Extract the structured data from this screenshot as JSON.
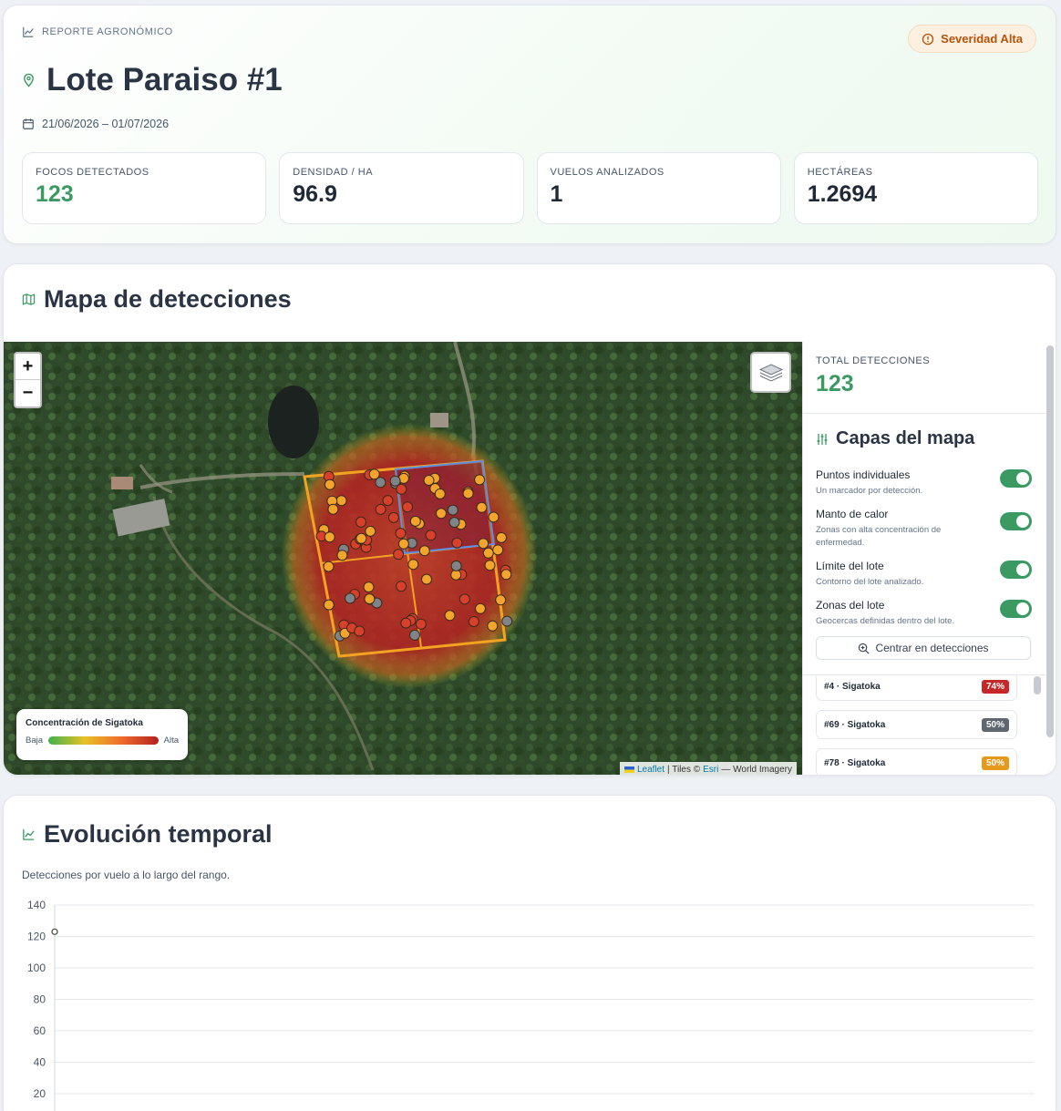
{
  "header": {
    "eyebrow": "REPORTE AGRONÓMICO",
    "severity_badge": "Severidad Alta",
    "title": "Lote Paraiso #1",
    "date_range": "21/06/2026 – 01/07/2026"
  },
  "stats": [
    {
      "label": "FOCOS DETECTADOS",
      "value": "123"
    },
    {
      "label": "DENSIDAD / HA",
      "value": "96.9"
    },
    {
      "label": "VUELOS ANALIZADOS",
      "value": "1"
    },
    {
      "label": "HECTÁREAS",
      "value": "1.2694"
    }
  ],
  "map_section": {
    "title": "Mapa de detecciones",
    "zoom_in": "+",
    "zoom_out": "−",
    "legend": {
      "title": "Concentración de Sigatoka",
      "low": "Baja",
      "high": "Alta"
    },
    "attribution": {
      "leaflet": "Leaflet",
      "sep1": "| Tiles ©",
      "esri": "Esri",
      "rest": "— World Imagery"
    }
  },
  "panel": {
    "total_label": "TOTAL DETECCIONES",
    "total_value": "123",
    "layers_title": "Capas del mapa",
    "layers": [
      {
        "name": "Puntos individuales",
        "desc": "Un marcador por detección.",
        "on": true
      },
      {
        "name": "Manto de calor",
        "desc": "Zonas con alta concentración de enfermedad.",
        "on": true
      },
      {
        "name": "Límite del lote",
        "desc": "Contorno del lote analizado.",
        "on": true
      },
      {
        "name": "Zonas del lote",
        "desc": "Geocercas definidas dentro del lote.",
        "on": true
      }
    ],
    "center_button": "Centrar en detecciones",
    "detections": [
      {
        "label": "#4 · Sigatoka",
        "pct": "74%",
        "color": "#c62828"
      },
      {
        "label": "#69 · Sigatoka",
        "pct": "50%",
        "color": "#5f6670"
      },
      {
        "label": "#78 · Sigatoka",
        "pct": "50%",
        "color": "#e69a1d"
      }
    ]
  },
  "chart_section": {
    "title": "Evolución temporal",
    "subtitle": "Detecciones por vuelo a lo largo del rango."
  },
  "chart_data": {
    "type": "line",
    "title": "",
    "xlabel": "",
    "ylabel": "",
    "ylim": [
      0,
      140
    ],
    "yticks": [
      140,
      120,
      100,
      80,
      60,
      40,
      20
    ],
    "grid": true,
    "series": [
      {
        "values": [
          123
        ]
      }
    ]
  },
  "colors": {
    "accent": "#3a9a62",
    "severity": "#b45309"
  }
}
